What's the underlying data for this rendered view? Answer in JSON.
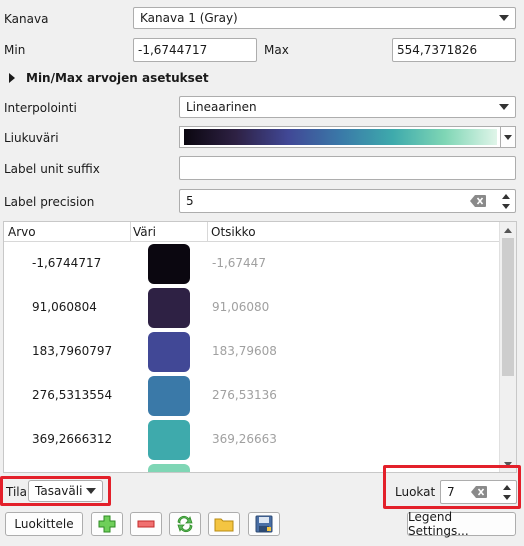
{
  "kanava": {
    "label": "Kanava",
    "value": "Kanava 1 (Gray)"
  },
  "min": {
    "label": "Min",
    "value": "-1,6744717"
  },
  "max": {
    "label": "Max",
    "value": "554,7371826"
  },
  "minmax_section": {
    "label": "Min/Max arvojen asetukset"
  },
  "interpolation": {
    "label": "Interpolointi",
    "value": "Lineaarinen"
  },
  "ramp": {
    "label": "Liukuväri",
    "colors": [
      "#0b0710",
      "#2e2144",
      "#414896",
      "#3a79a8",
      "#3eaaac",
      "#7fd6b5",
      "#e0f5e9"
    ]
  },
  "unit_suffix": {
    "label": "Label unit suffix",
    "value": ""
  },
  "precision": {
    "label": "Label precision",
    "value": "5"
  },
  "table": {
    "headers": [
      "Arvo",
      "Väri",
      "Otsikko"
    ],
    "rows": [
      {
        "value": "-1,6744717",
        "color": "#0b0710",
        "label": "-1,67447"
      },
      {
        "value": "91,060804",
        "color": "#2e2144",
        "label": "91,06080"
      },
      {
        "value": "183,7960797",
        "color": "#414896",
        "label": "183,79608"
      },
      {
        "value": "276,5313554",
        "color": "#3a79a8",
        "label": "276,53136"
      },
      {
        "value": "369,2666312",
        "color": "#3eaaac",
        "label": "369,26663"
      }
    ],
    "partial_color": "#7fd6b5"
  },
  "mode": {
    "label": "Tila",
    "value": "Tasaväli"
  },
  "classes": {
    "label": "Luokat",
    "value": "7"
  },
  "buttons": {
    "classify": "Luokittele",
    "legend": "Legend Settings..."
  },
  "highlight_color": "#e3202a"
}
